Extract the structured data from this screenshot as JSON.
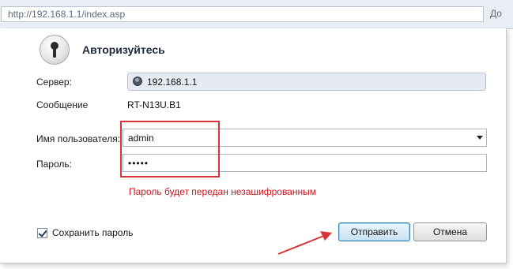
{
  "browser": {
    "address": "http://192.168.1.1/index.asp",
    "cut_text": "До"
  },
  "dialog": {
    "title": "Авторизуйтесь",
    "server_label": "Сервер:",
    "server_value": "192.168.1.1",
    "message_label": "Сообщение",
    "message_value": "RT-N13U.B1",
    "username_label": "Имя пользователя:",
    "username_value": "admin",
    "password_label": "Пароль:",
    "password_value": "•••••",
    "warning": "Пароль будет передан незашифрованным",
    "save_password_label": "Сохранить пароль",
    "save_password_checked": true,
    "submit_label": "Отправить",
    "cancel_label": "Отмена"
  },
  "annotations": {
    "highlight_color": "#d9343a",
    "arrow_color": "#d9343a"
  }
}
